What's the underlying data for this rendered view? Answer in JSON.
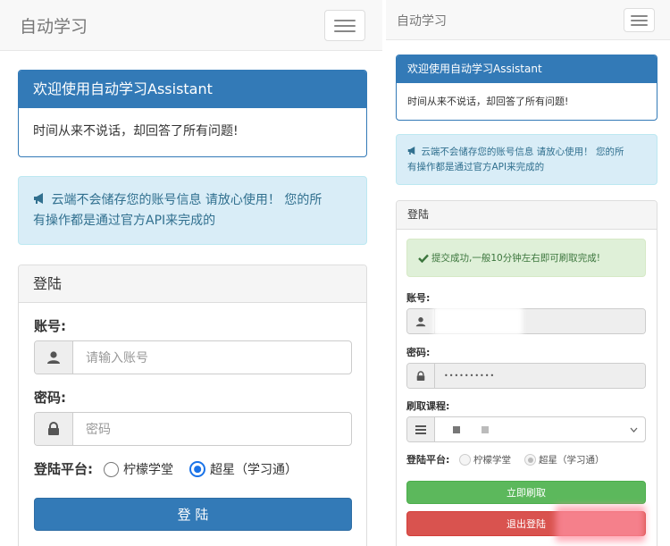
{
  "left": {
    "brand": "自动学习",
    "welcome": {
      "title": "欢迎使用自动学习Assistant",
      "body": "时间从来不说话，却回答了所有问题!"
    },
    "notice": {
      "line1": "云端不会储存您的账号信息 请放心使用！ 您的所",
      "line2": "有操作都是通过官方API来完成的"
    },
    "login": {
      "title": "登陆",
      "account_label": "账号:",
      "account_placeholder": "请输入账号",
      "password_label": "密码:",
      "password_placeholder": "密码",
      "platform_label": "登陆平台:",
      "platform_options": [
        "柠檬学堂",
        "超星（学习通）"
      ],
      "selected_platform": "超星（学习通）",
      "submit": "登 陆"
    }
  },
  "right": {
    "brand": "自动学习",
    "welcome": {
      "title": "欢迎使用自动学习Assistant",
      "body": "时间从来不说话，却回答了所有问题!"
    },
    "notice": {
      "line1": "云端不会储存您的账号信息 请放心使用！ 您的所",
      "line2": "有操作都是通过官方API来完成的"
    },
    "login": {
      "title": "登陆",
      "success": "提交成功,一般10分钟左右即可刷取完成!",
      "account_label": "账号:",
      "password_label": "密码:",
      "password_value": "••••••••••",
      "course_label": "刷取课程:",
      "platform_label": "登陆平台:",
      "platform_options": [
        "柠檬学堂",
        "超星（学习通）"
      ],
      "selected_platform": "超星（学习通）",
      "start": "立即刷取",
      "logout": "退出登陆"
    }
  },
  "colors": {
    "primary": "#337ab7",
    "info_bg": "#d9edf7",
    "info_text": "#31708f",
    "success_bg": "#dff0d8",
    "success_text": "#3c763d",
    "btn_success": "#5cb85c",
    "btn_danger": "#d9534f"
  },
  "icons": [
    "menu-icon",
    "bullhorn-icon",
    "user-icon",
    "lock-icon",
    "list-icon",
    "checkmark-icon",
    "chevron-down-icon"
  ]
}
